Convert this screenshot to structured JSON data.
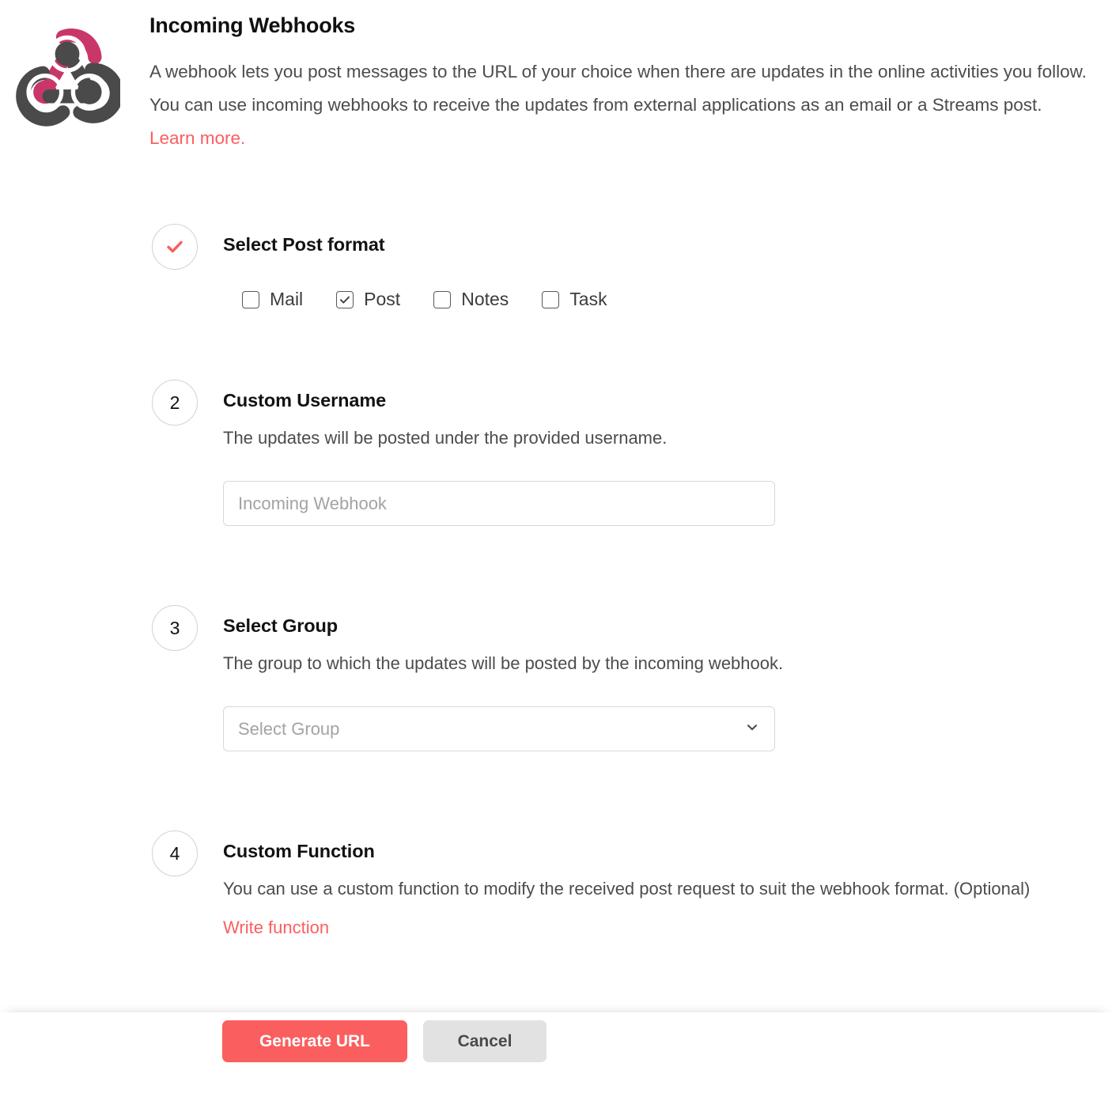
{
  "header": {
    "logo_icon": "webhook-logo-icon",
    "title": "Incoming Webhooks",
    "description_part1": "A webhook lets you post messages to the URL of your choice when there are updates in the online activities you follow. You can use incoming webhooks to receive the updates from external applications as an email or a Streams post. ",
    "learn_more_label": "Learn more."
  },
  "steps": [
    {
      "badge": "check",
      "badge_icon": "check-icon",
      "title": "Select Post format",
      "options": [
        {
          "label": "Mail",
          "checked": false
        },
        {
          "label": "Post",
          "checked": true
        },
        {
          "label": "Notes",
          "checked": false
        },
        {
          "label": "Task",
          "checked": false
        }
      ]
    },
    {
      "badge": "2",
      "title": "Custom Username",
      "description": "The updates will be posted under the provided username.",
      "input_placeholder": "Incoming Webhook",
      "input_value": ""
    },
    {
      "badge": "3",
      "title": "Select Group",
      "description": "The group to which the updates will be posted by the incoming webhook.",
      "select_value": "Select Group",
      "chevron_icon": "chevron-down-icon"
    },
    {
      "badge": "4",
      "title": "Custom Function",
      "description": "You can use a custom function to modify the received post request to suit the webhook format. (Optional)",
      "link_label": "Write function"
    }
  ],
  "footer": {
    "primary_label": "Generate URL",
    "secondary_label": "Cancel"
  },
  "colors": {
    "accent_red": "#fb5e5e",
    "logo_pink": "#c8republic",
    "logo_pink_hex": "#c9376a",
    "logo_dark": "#4a4a4a",
    "secondary_button": "#e2e2e2",
    "border_gray": "#d8d8d8",
    "placeholder_gray": "#a3a3a3"
  }
}
